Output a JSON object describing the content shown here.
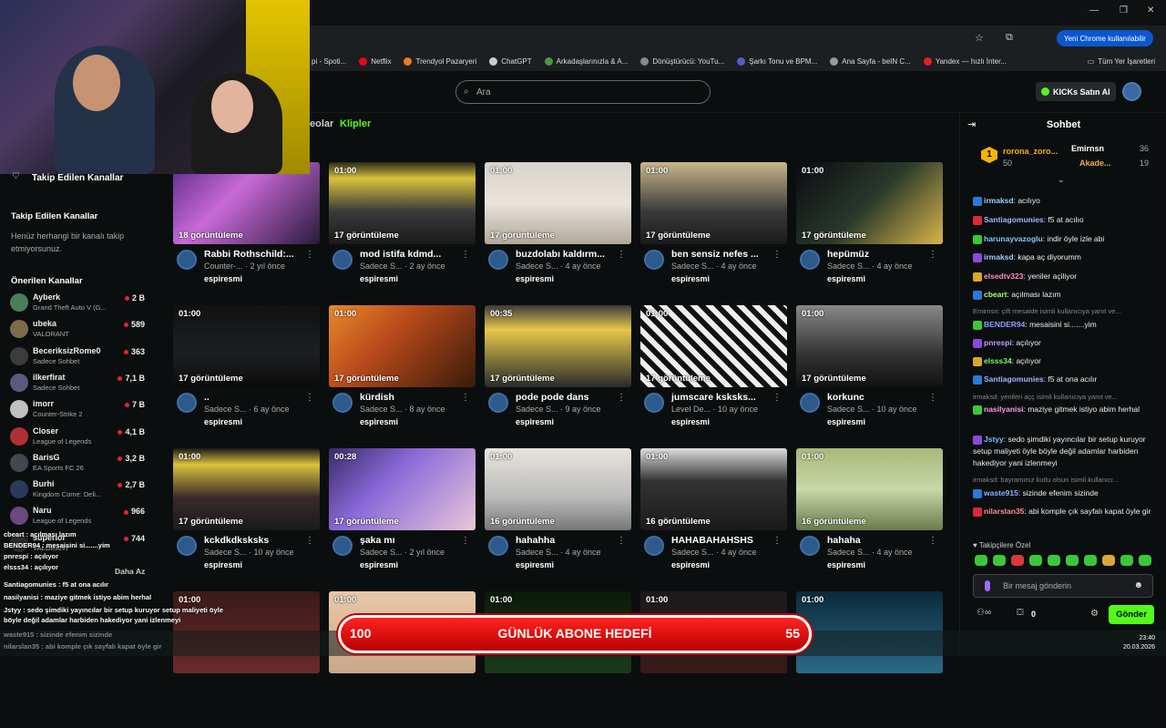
{
  "browser": {
    "bookmarks": [
      "pi - Spoti...",
      "Netflix",
      "Trendyol Pazaryeri",
      "ChatGPT",
      "Arkadaşlarınızla & A...",
      "Dönüştürücü: YouTu...",
      "Şarkı Tonu ve BPM...",
      "Ana Sayfa - beIN C...",
      "Yandex — hızlı İnter...",
      "Tüm Yer İşaretleri"
    ],
    "chrome_button": "Yeni Chrome kullanılabilir"
  },
  "header": {
    "search_placeholder": "Ara",
    "kicks_button": "KICKs Satın Al"
  },
  "tabs": {
    "videos": "eolar",
    "clips": "Klipler"
  },
  "sidebar": {
    "followed_link": "Takip Edilen Kanallar",
    "followed_title": "Takip Edilen Kanallar",
    "followed_empty": "Henüz herhangi bir kanalı takip etmiyorsunuz.",
    "suggested_title": "Önerilen Kanallar",
    "channels": [
      {
        "name": "Ayberk",
        "game": "Grand Theft Auto V (G...",
        "viewers": "2 B"
      },
      {
        "name": "ubeka",
        "game": "VALORANT",
        "viewers": "589"
      },
      {
        "name": "BeceriksizRome0",
        "game": "Sadece Sohbet",
        "viewers": "363"
      },
      {
        "name": "ilkerfirat",
        "game": "Sadece Sohbet",
        "viewers": "7,1 B"
      },
      {
        "name": "imorr",
        "game": "Counter-Strike 2",
        "viewers": "7 B"
      },
      {
        "name": "Closer",
        "game": "League of Legends",
        "viewers": "4,1 B"
      },
      {
        "name": "BarisG",
        "game": "EA Sports FC 26",
        "viewers": "3,2 B"
      },
      {
        "name": "Burhi",
        "game": "Kingdom Come: Deli...",
        "viewers": "2,7 B"
      },
      {
        "name": "Naru",
        "game": "League of Legends",
        "viewers": "966"
      },
      {
        "name": "superior",
        "game": "VALORANT",
        "viewers": "744"
      }
    ],
    "more": "Daha Az"
  },
  "overlay_chat": [
    "cbeart : açılması lazım",
    "BENDER94 : mesaisini si.......yim",
    "pnrespi : açılıyor",
    "elsss34 : açılıyor",
    "Santiagomunies : f5 at ona acılır",
    "nasilyanisi : maziye gitmek istiyo abim herhal",
    "Jstyy : sedo şimdiki yayıncılar bir setup kuruyor setup maliyeti öyle",
    "böyle değil adamlar harbiden hakediyor yani izlenmeyi",
    "waste915 : sizinde efenim sizinde",
    "nilarslan35 : abi komple çık sayfalı kapat öyle gir"
  ],
  "clips": [
    {
      "dur": "",
      "views": "18 görüntüleme",
      "title": "Rabbi Rothschild:...",
      "meta": "Counter-... · 2 yıl önce",
      "creator": "espiresmi"
    },
    {
      "dur": "01:00",
      "views": "17 görüntüleme",
      "title": "mod istifa kdmd...",
      "meta": "Sadece S... · 2 ay önce",
      "creator": "espiresmi"
    },
    {
      "dur": "01:00",
      "views": "17 görüntüleme",
      "title": "buzdolabı kaldırm...",
      "meta": "Sadece S... · 4 ay önce",
      "creator": "espiresmi"
    },
    {
      "dur": "01:00",
      "views": "17 görüntüleme",
      "title": "ben sensiz nefes ...",
      "meta": "Sadece S... · 4 ay önce",
      "creator": "espiresmi"
    },
    {
      "dur": "01:00",
      "views": "17 görüntüleme",
      "title": "hepümüz",
      "meta": "Sadece S... · 4 ay önce",
      "creator": "espiresmi"
    },
    {
      "dur": "01:00",
      "views": "17 görüntüleme",
      "title": "..",
      "meta": "Sadece S... · 6 ay önce",
      "creator": "espiresmi"
    },
    {
      "dur": "01:00",
      "views": "17 görüntüleme",
      "title": "kürdish",
      "meta": "Sadece S... · 8 ay önce",
      "creator": "espiresmi"
    },
    {
      "dur": "00:35",
      "views": "17 görüntüleme",
      "title": "pode pode dans",
      "meta": "Sadece S... · 9 ay önce",
      "creator": "espiresmi"
    },
    {
      "dur": "01:00",
      "views": "17 görüntüleme",
      "title": "jumscare ksksks...",
      "meta": "Level De... · 10 ay önce",
      "creator": "espiresmi"
    },
    {
      "dur": "01:00",
      "views": "17 görüntüleme",
      "title": "korkunc",
      "meta": "Sadece S... · 10 ay önce",
      "creator": "espiresmi"
    },
    {
      "dur": "01:00",
      "views": "17 görüntüleme",
      "title": "kckdkdksksks",
      "meta": "Sadece S... · 10 ay önce",
      "creator": "espiresmi"
    },
    {
      "dur": "00:28",
      "views": "17 görüntüleme",
      "title": "şaka mı",
      "meta": "Sadece S... · 2 yıl önce",
      "creator": "espiresmi"
    },
    {
      "dur": "01:00",
      "views": "16 görüntüleme",
      "title": "hahahha",
      "meta": "Sadece S... · 4 ay önce",
      "creator": "espiresmi"
    },
    {
      "dur": "01:00",
      "views": "16 görüntüleme",
      "title": "HAHABAHAHSHS",
      "meta": "Sadece S... · 4 ay önce",
      "creator": "espiresmi"
    },
    {
      "dur": "01:00",
      "views": "16 görüntüleme",
      "title": "hahaha",
      "meta": "Sadece S... · 4 ay önce",
      "creator": "espiresmi"
    },
    {
      "dur": "01:00"
    },
    {
      "dur": "01:00"
    },
    {
      "dur": "01:00"
    },
    {
      "dur": "01:00"
    },
    {
      "dur": "01:00"
    }
  ],
  "chat": {
    "title": "Sohbet",
    "leaders": [
      {
        "name": "rorona_zoro...",
        "value": "50"
      },
      {
        "name": "Emirnsn",
        "value": "36"
      },
      {
        "name": "Akade...",
        "value": "19"
      }
    ],
    "messages": [
      {
        "user": "irmaksd",
        "text": ": acılıyo"
      },
      {
        "user": "Santiagomunies",
        "text": ": f5 at acılıo"
      },
      {
        "user": "harunayvazoglu",
        "text": ": indir öyle izle abi"
      },
      {
        "user": "irmaksd",
        "text": ": kapa aç diyorumm"
      },
      {
        "user": "elsedtv323",
        "text": ": yeniler açiliyor"
      },
      {
        "user": "cbeart",
        "text": ": açılması lazım"
      },
      {
        "reply": "Emirnsn: çift mesaide isimli kullanıcıya yanıt ve..."
      },
      {
        "user": "BENDER94",
        "text": ": mesaisini si.......yim"
      },
      {
        "user": "pnrespi",
        "text": ": açılıyor"
      },
      {
        "user": "elsss34",
        "text": ": açılıyor"
      },
      {
        "user": "Santiagomunies",
        "text": ": f5 at ona acılır"
      },
      {
        "reply": "irmaksd: yenileri açç isimli kullanıcıya yanıt ve..."
      },
      {
        "user": "nasilyanisi",
        "text": ": maziye gitmek istiyo abim herhal"
      },
      {
        "user": "Jstyy",
        "text": ": sedo şimdiki yayıncılar bir setup kuruyor setup maliyeti öyle böyle değil adamlar harbiden hakediyor yani izlenmeyi"
      },
      {
        "reply": "irmaksd: bayramınız kutlu olsun isimli kullanıcı..."
      },
      {
        "user": "waste915",
        "text": ": sizinde efenim sizinde"
      },
      {
        "user": "nilarslan35",
        "text": ": abi komple çık sayfalı kapat öyle gir"
      }
    ],
    "emote_title": "Takipçilere Özel",
    "input_placeholder": "Bir mesaj gönderin",
    "count": "0",
    "send": "Gönder"
  },
  "goal": {
    "left": "100",
    "title": "GÜNLÜK ABONE HEDEFİ",
    "right": "55"
  },
  "clock": {
    "time": "23:40",
    "date": "20.03.2026"
  },
  "colors": {
    "accent": "#53fc18",
    "goal_red": "#e01818"
  }
}
